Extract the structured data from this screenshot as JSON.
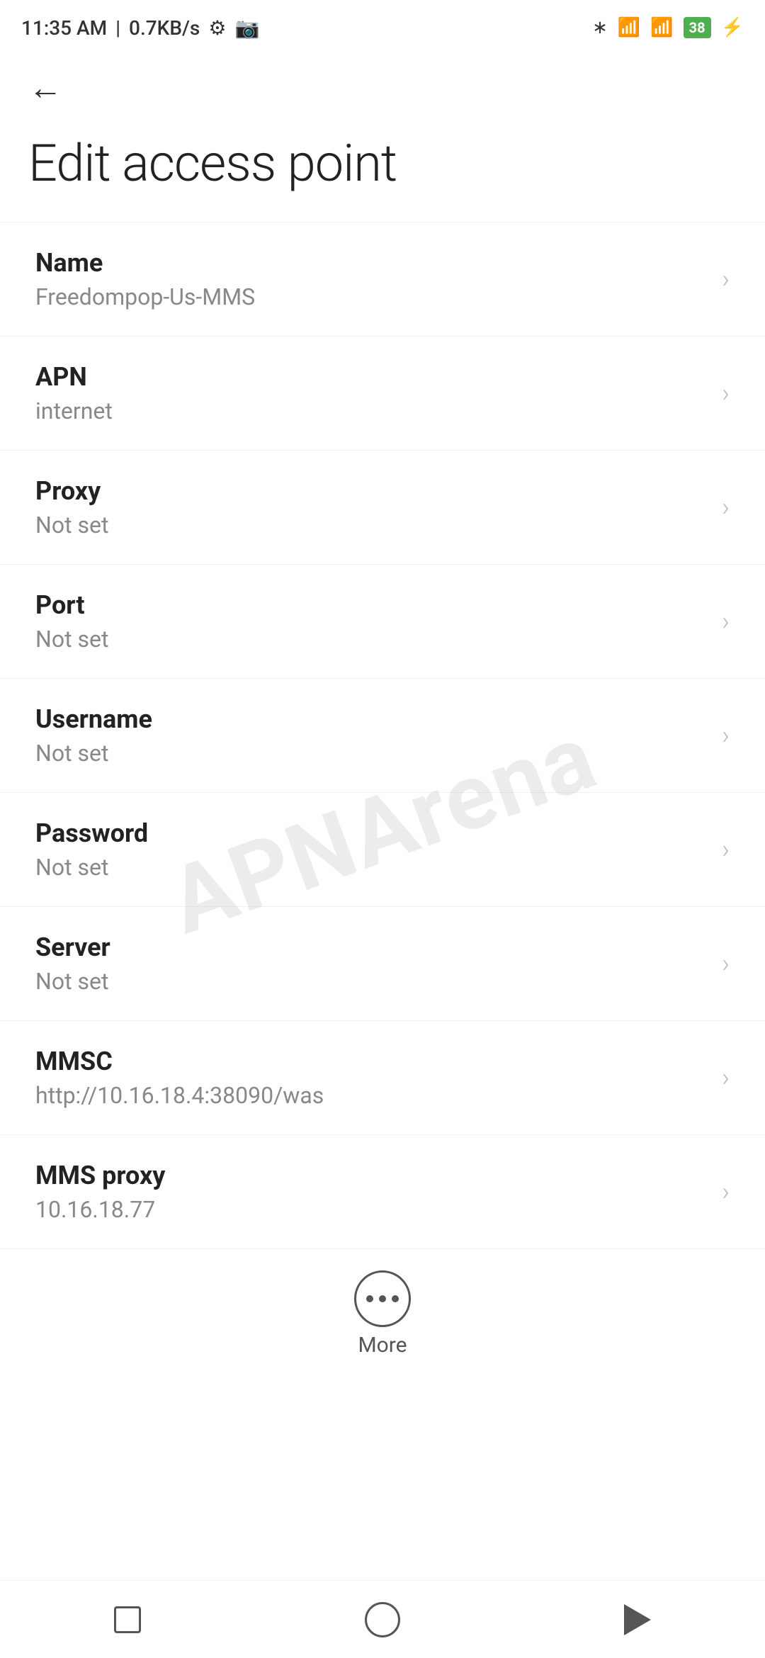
{
  "statusBar": {
    "time": "11:35 AM",
    "speed": "0.7KB/s",
    "battery": "38"
  },
  "header": {
    "backLabel": "←",
    "title": "Edit access point"
  },
  "items": [
    {
      "label": "Name",
      "value": "Freedompop-Us-MMS"
    },
    {
      "label": "APN",
      "value": "internet"
    },
    {
      "label": "Proxy",
      "value": "Not set"
    },
    {
      "label": "Port",
      "value": "Not set"
    },
    {
      "label": "Username",
      "value": "Not set"
    },
    {
      "label": "Password",
      "value": "Not set"
    },
    {
      "label": "Server",
      "value": "Not set"
    },
    {
      "label": "MMSC",
      "value": "http://10.16.18.4:38090/was"
    },
    {
      "label": "MMS proxy",
      "value": "10.16.18.77"
    }
  ],
  "more": {
    "label": "More"
  },
  "watermark": "APNArena"
}
